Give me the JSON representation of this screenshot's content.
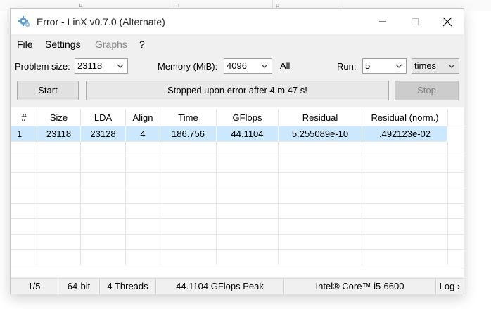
{
  "window": {
    "title": "Error - LinX v0.7.0 (Alternate)"
  },
  "background": {
    "col_letters": [
      "д",
      "т",
      "р"
    ]
  },
  "menu": {
    "file": "File",
    "settings": "Settings",
    "graphs": "Graphs",
    "help": "?"
  },
  "controls": {
    "problem_size_label": "Problem size:",
    "problem_size_value": "23118",
    "memory_label": "Memory (MiB):",
    "memory_value": "4096",
    "all_label": "All",
    "run_label": "Run:",
    "run_value": "5",
    "times_value": "times",
    "start_label": "Start",
    "status_text": "Stopped upon error after 4 m 47 s!",
    "stop_label": "Stop"
  },
  "table": {
    "headers": [
      "#",
      "Size",
      "LDA",
      "Align",
      "Time",
      "GFlops",
      "Residual",
      "Residual (norm.)"
    ],
    "rows": [
      [
        "1",
        "23118",
        "23128",
        "4",
        "186.756",
        "44.1104",
        "5.255089e-10",
        ".492123e-02"
      ]
    ]
  },
  "statusbar": {
    "progress": "1/5",
    "bits": "64-bit",
    "threads": "4 Threads",
    "peak": "44.1104 GFlops Peak",
    "cpu": "Intel® Core™ i5-6600",
    "log": "Log ›"
  },
  "colors": {
    "selected_row": "#cce8ff",
    "window_bg": "#f0f0f0"
  },
  "icons": {
    "app": "gear-icon",
    "minimize": "minimize-icon",
    "maximize": "maximize-icon",
    "close": "close-icon",
    "dropdown": "chevron-down-icon"
  }
}
